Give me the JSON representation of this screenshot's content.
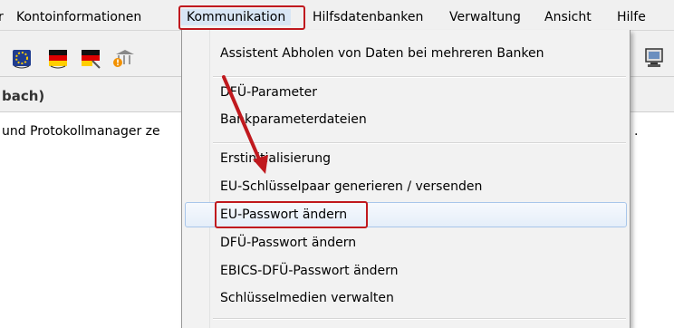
{
  "menubar": {
    "items": [
      {
        "label": "r"
      },
      {
        "label": "Kontoinformationen"
      },
      {
        "label": "Kommunikation"
      },
      {
        "label": "Hilfsdatenbanken"
      },
      {
        "label": "Verwaltung"
      },
      {
        "label": "Ansicht"
      },
      {
        "label": "Hilfe"
      }
    ]
  },
  "breadcrumb": {
    "text": "bach)"
  },
  "status": {
    "text": "und Protokollmanager ze",
    "trailing": "."
  },
  "dropdown": {
    "items": [
      {
        "label": "Assistent Abholen von Daten bei mehreren Banken"
      },
      {
        "label": "DFÜ-Parameter"
      },
      {
        "label": "Bankparameterdateien"
      },
      {
        "label": "Erstinitialisierung"
      },
      {
        "label": "EU-Schlüsselpaar generieren / versenden"
      },
      {
        "label": "EU-Passwort ändern"
      },
      {
        "label": "DFÜ-Passwort ändern"
      },
      {
        "label": "EBICS-DFÜ-Passwort ändern"
      },
      {
        "label": "Schlüsselmedien verwalten"
      }
    ]
  },
  "colors": {
    "highlight_box": "#c0191e",
    "menubar_bg": "#f0f0f0",
    "hover_border": "#a8c6ea"
  },
  "icons": [
    "eu-flag-icon",
    "german-flag-icon",
    "german-flag-card-icon",
    "bank-warning-icon",
    "monitor-icon"
  ]
}
